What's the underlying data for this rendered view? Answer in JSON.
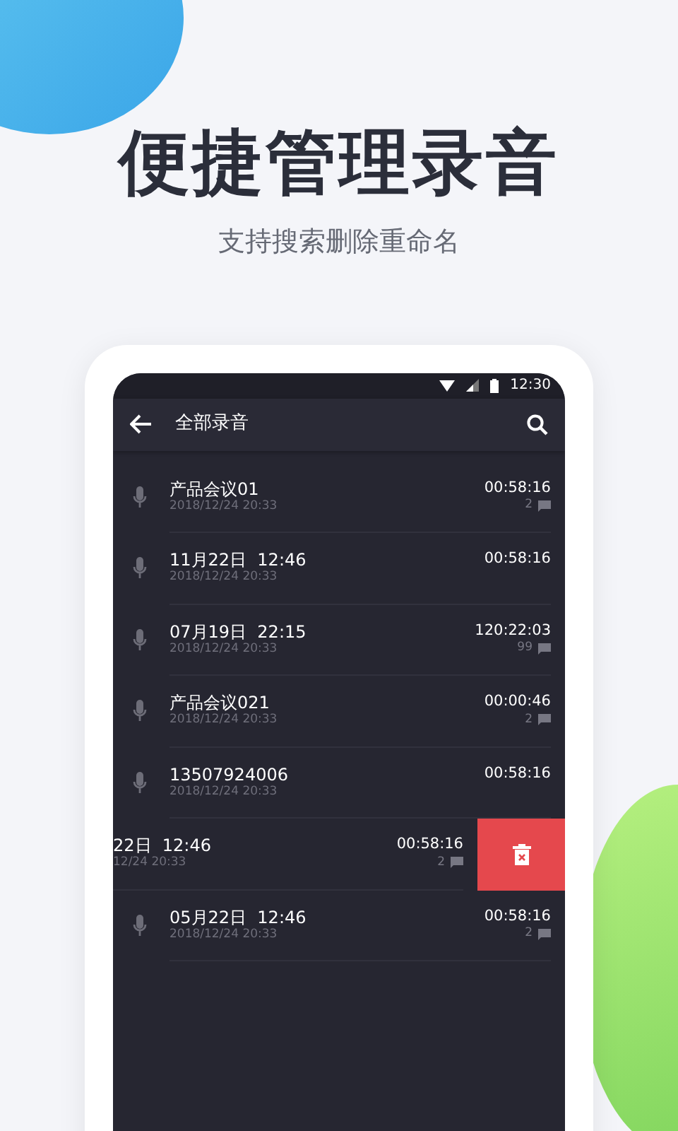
{
  "headline": "便捷管理录音",
  "subtitle": "支持搜索删除重命名",
  "status_bar": {
    "time": "12:30"
  },
  "toolbar": {
    "title": "全部录音"
  },
  "recordings": [
    {
      "title": "产品会议01",
      "date": "2018/12/24 20:33",
      "duration": "00:58:16",
      "marks": "2",
      "swiped": false
    },
    {
      "title": "11月22日  12:46",
      "date": "2018/12/24 20:33",
      "duration": "00:58:16",
      "swiped": false
    },
    {
      "title": "07月19日  22:15",
      "date": "2018/12/24 20:33",
      "duration": "120:22:03",
      "marks": "99",
      "swiped": false
    },
    {
      "title": "产品会议021",
      "date": "2018/12/24 20:33",
      "duration": "00:00:46",
      "marks": "2",
      "swiped": false
    },
    {
      "title": "13507924006",
      "date": "2018/12/24 20:33",
      "duration": "00:58:16",
      "swiped": false
    },
    {
      "title": "22日  12:46",
      "date": "12/24 20:33",
      "duration": "00:58:16",
      "marks": "2",
      "swiped": true
    },
    {
      "title": "05月22日  12:46",
      "date": "2018/12/24 20:33",
      "duration": "00:58:16",
      "marks": "2",
      "swiped": false
    }
  ]
}
